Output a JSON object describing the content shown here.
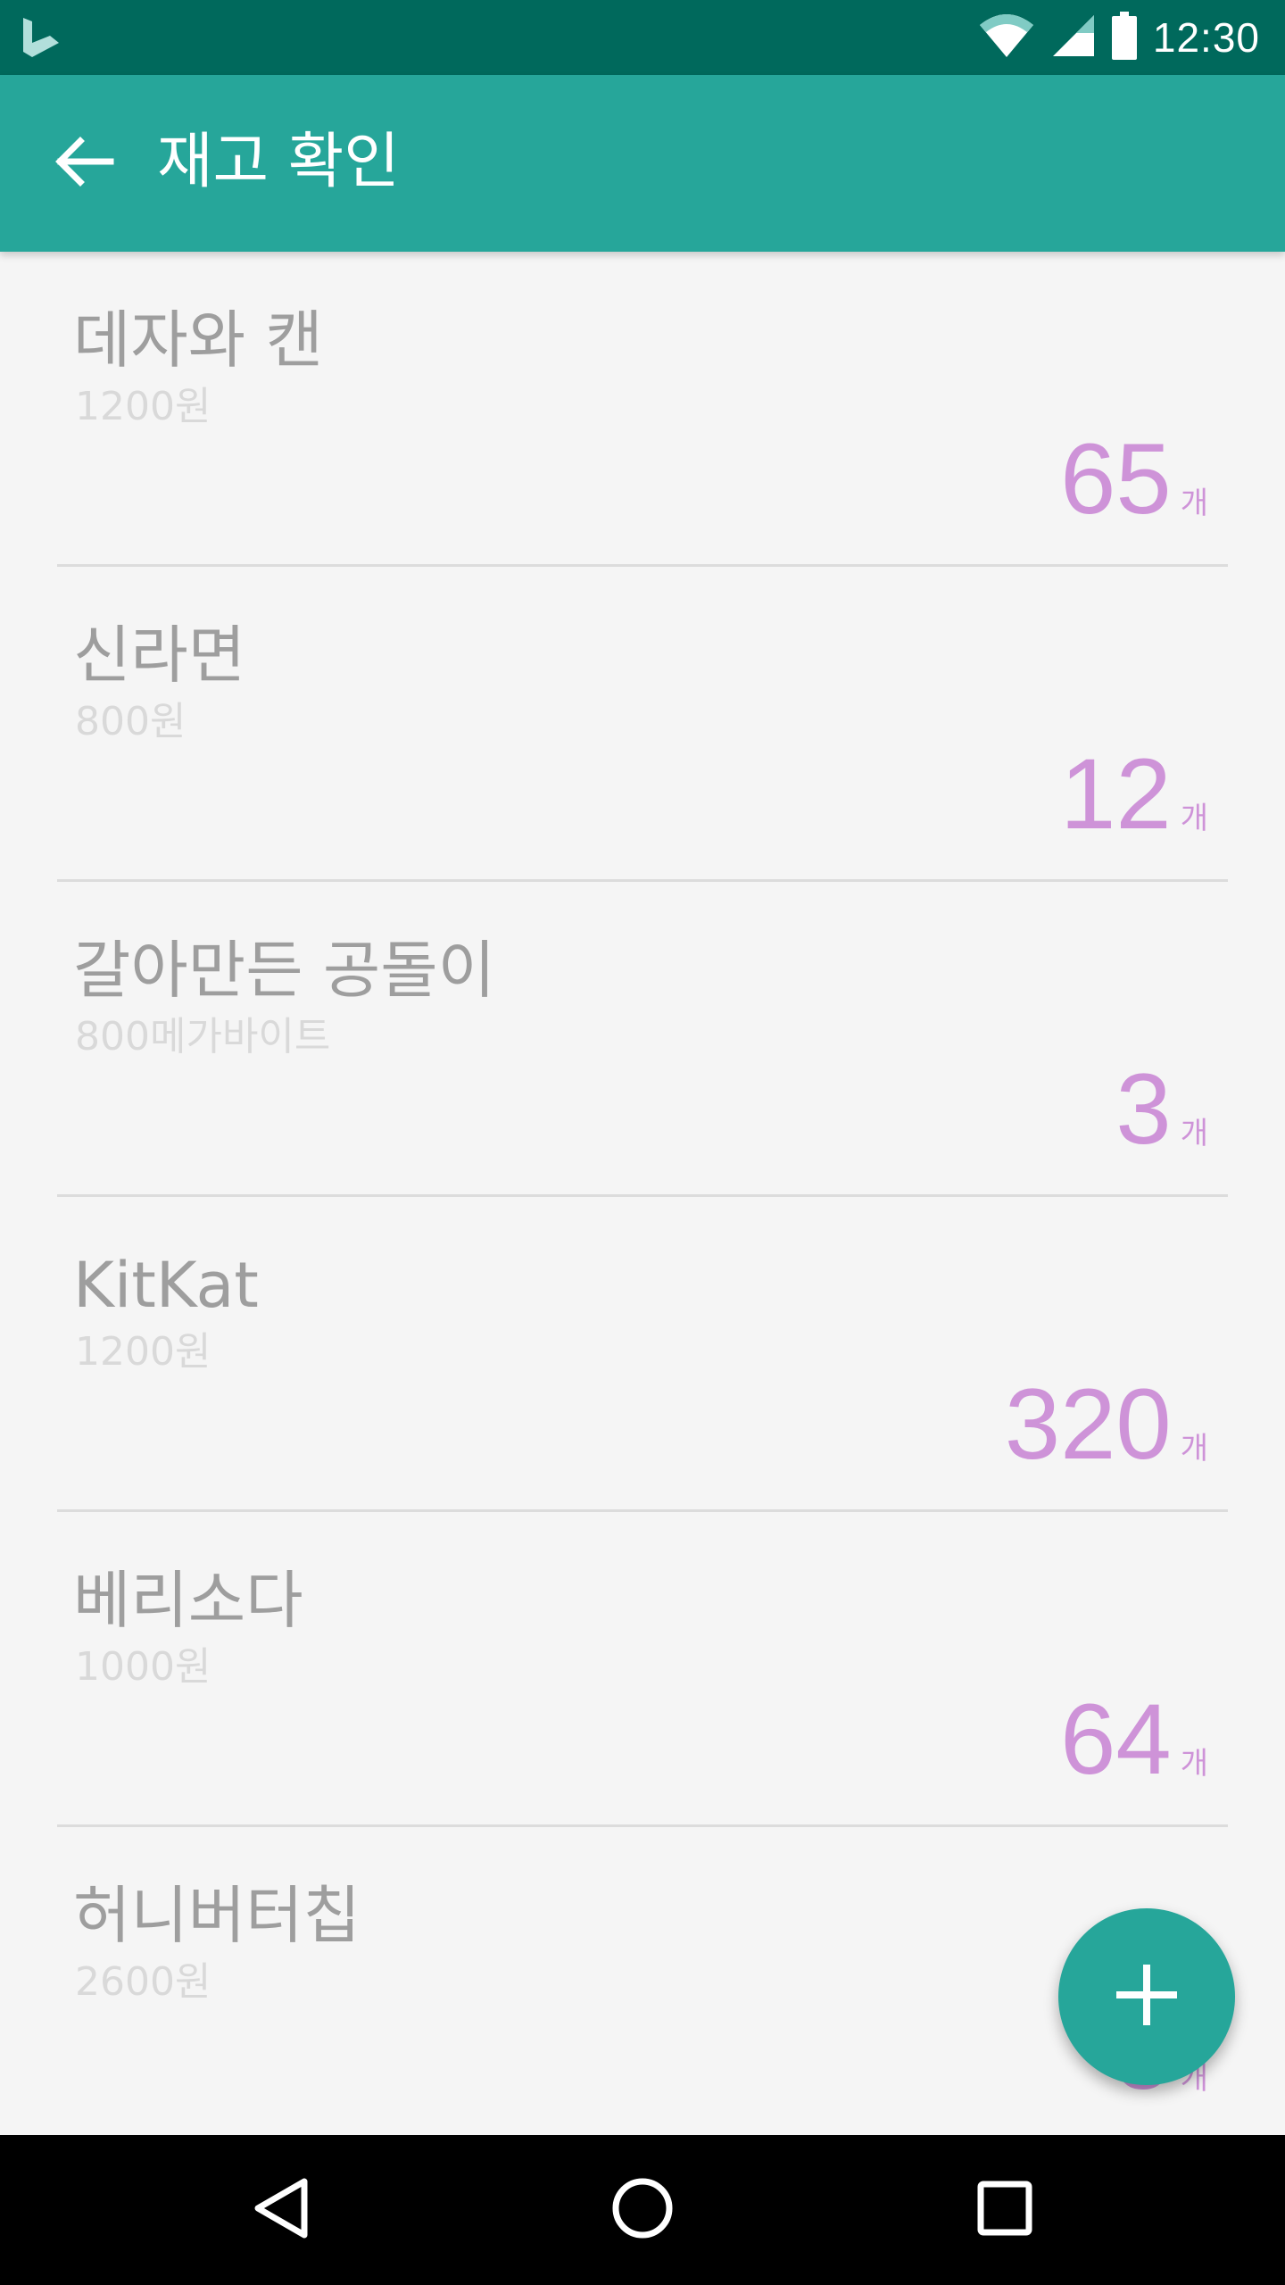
{
  "status_bar": {
    "time": "12:30",
    "icons": [
      "bing-logo-icon",
      "wifi-icon",
      "signal-icon",
      "battery-icon"
    ]
  },
  "app_bar": {
    "title": "재고 확인",
    "back_icon": "arrow-back-icon"
  },
  "items": [
    {
      "name": "데자와 캔",
      "price": "1200원",
      "quantity": "65",
      "unit": "개"
    },
    {
      "name": "신라면",
      "price": "800원",
      "quantity": "12",
      "unit": "개"
    },
    {
      "name": "갈아만든 공돌이",
      "price": "800메가바이트",
      "quantity": "3",
      "unit": "개"
    },
    {
      "name": "KitKat",
      "price": "1200원",
      "quantity": "320",
      "unit": "개"
    },
    {
      "name": "베리소다",
      "price": "1000원",
      "quantity": "64",
      "unit": "개"
    },
    {
      "name": "허니버터칩",
      "price": "2600원",
      "quantity": "5",
      "unit": "개"
    }
  ],
  "fab": {
    "icon": "plus-icon"
  },
  "nav_bar": {
    "icons": [
      "back-triangle-icon",
      "home-circle-icon",
      "recents-square-icon"
    ]
  },
  "colors": {
    "status_bar": "#00695c",
    "app_bar": "#26a69a",
    "accent_quantity": "#ce93d8",
    "background": "#f5f5f5"
  }
}
